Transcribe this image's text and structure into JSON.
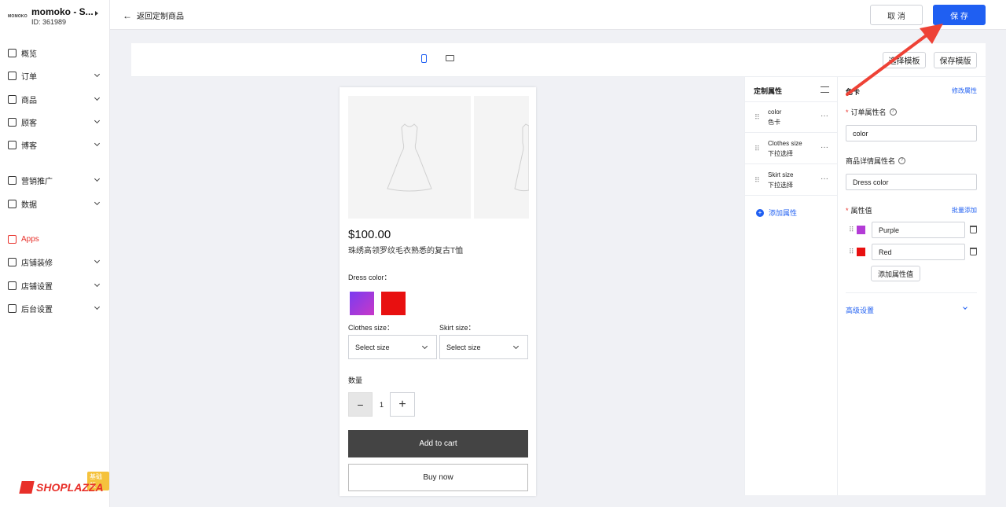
{
  "store": {
    "logo_text": "MOMOKO",
    "name": "momoko - S...",
    "id_text": "ID: 361989"
  },
  "sidebar": {
    "items": [
      {
        "label": "概览",
        "icon": "dashboard-icon",
        "chevron": false
      },
      {
        "label": "订单",
        "icon": "order-icon",
        "chevron": true
      },
      {
        "label": "商品",
        "icon": "product-icon",
        "chevron": true
      },
      {
        "label": "顾客",
        "icon": "customer-icon",
        "chevron": true
      },
      {
        "label": "博客",
        "icon": "blog-icon",
        "chevron": true
      },
      {
        "label": "营销推广",
        "icon": "marketing-icon",
        "chevron": true
      },
      {
        "label": "数据",
        "icon": "analytics-icon",
        "chevron": true
      },
      {
        "label": "Apps",
        "icon": "apps-icon",
        "chevron": false
      },
      {
        "label": "店铺装修",
        "icon": "theme-icon",
        "chevron": true
      },
      {
        "label": "店铺设置",
        "icon": "settings-icon",
        "chevron": true
      },
      {
        "label": "后台设置",
        "icon": "admin-icon",
        "chevron": true
      }
    ],
    "brand": "SHOPLAZZA",
    "edition": "基础版"
  },
  "topbar": {
    "back_label": "返回定制商品",
    "cancel_label": "取 消",
    "save_label": "保 存"
  },
  "toolbar": {
    "select_template": "选择模板",
    "save_template": "保存模版"
  },
  "preview": {
    "price": "$100.00",
    "title": "珠绣高领罗纹毛衣熟悉的复古T恤",
    "dress_color_label": "Dress color：",
    "clothes_size_label": "Clothes size：",
    "skirt_size_label": "Skirt size：",
    "select_placeholder": "Select size",
    "qty_label": "数量",
    "qty_value": "1",
    "minus": "−",
    "plus": "+",
    "add_to_cart": "Add to cart",
    "buy_now": "Buy now"
  },
  "attributes": {
    "header": "定制属性",
    "items": [
      {
        "name": "color",
        "type": "色卡"
      },
      {
        "name": "Clothes size",
        "type": "下拉选择"
      },
      {
        "name": "Skirt size",
        "type": "下拉选择"
      }
    ],
    "more": "···",
    "add_label": "添加属性"
  },
  "config": {
    "type_label": "色卡",
    "edit_label": "修改属性",
    "order_attr_label": "订单属性名",
    "order_attr_value": "color",
    "detail_attr_label": "商品详情属性名",
    "detail_attr_value": "Dress color",
    "values_label": "属性值",
    "batch_add": "批量添加",
    "values": [
      {
        "name": "Purple",
        "color": "#b33cd6"
      },
      {
        "name": "Red",
        "color": "#e81010"
      }
    ],
    "add_value": "添加属性值",
    "advanced": "高级设置"
  },
  "colors": {
    "accent": "#1f5ff2",
    "brand": "#e8302a",
    "annotation": "#ee4236"
  }
}
